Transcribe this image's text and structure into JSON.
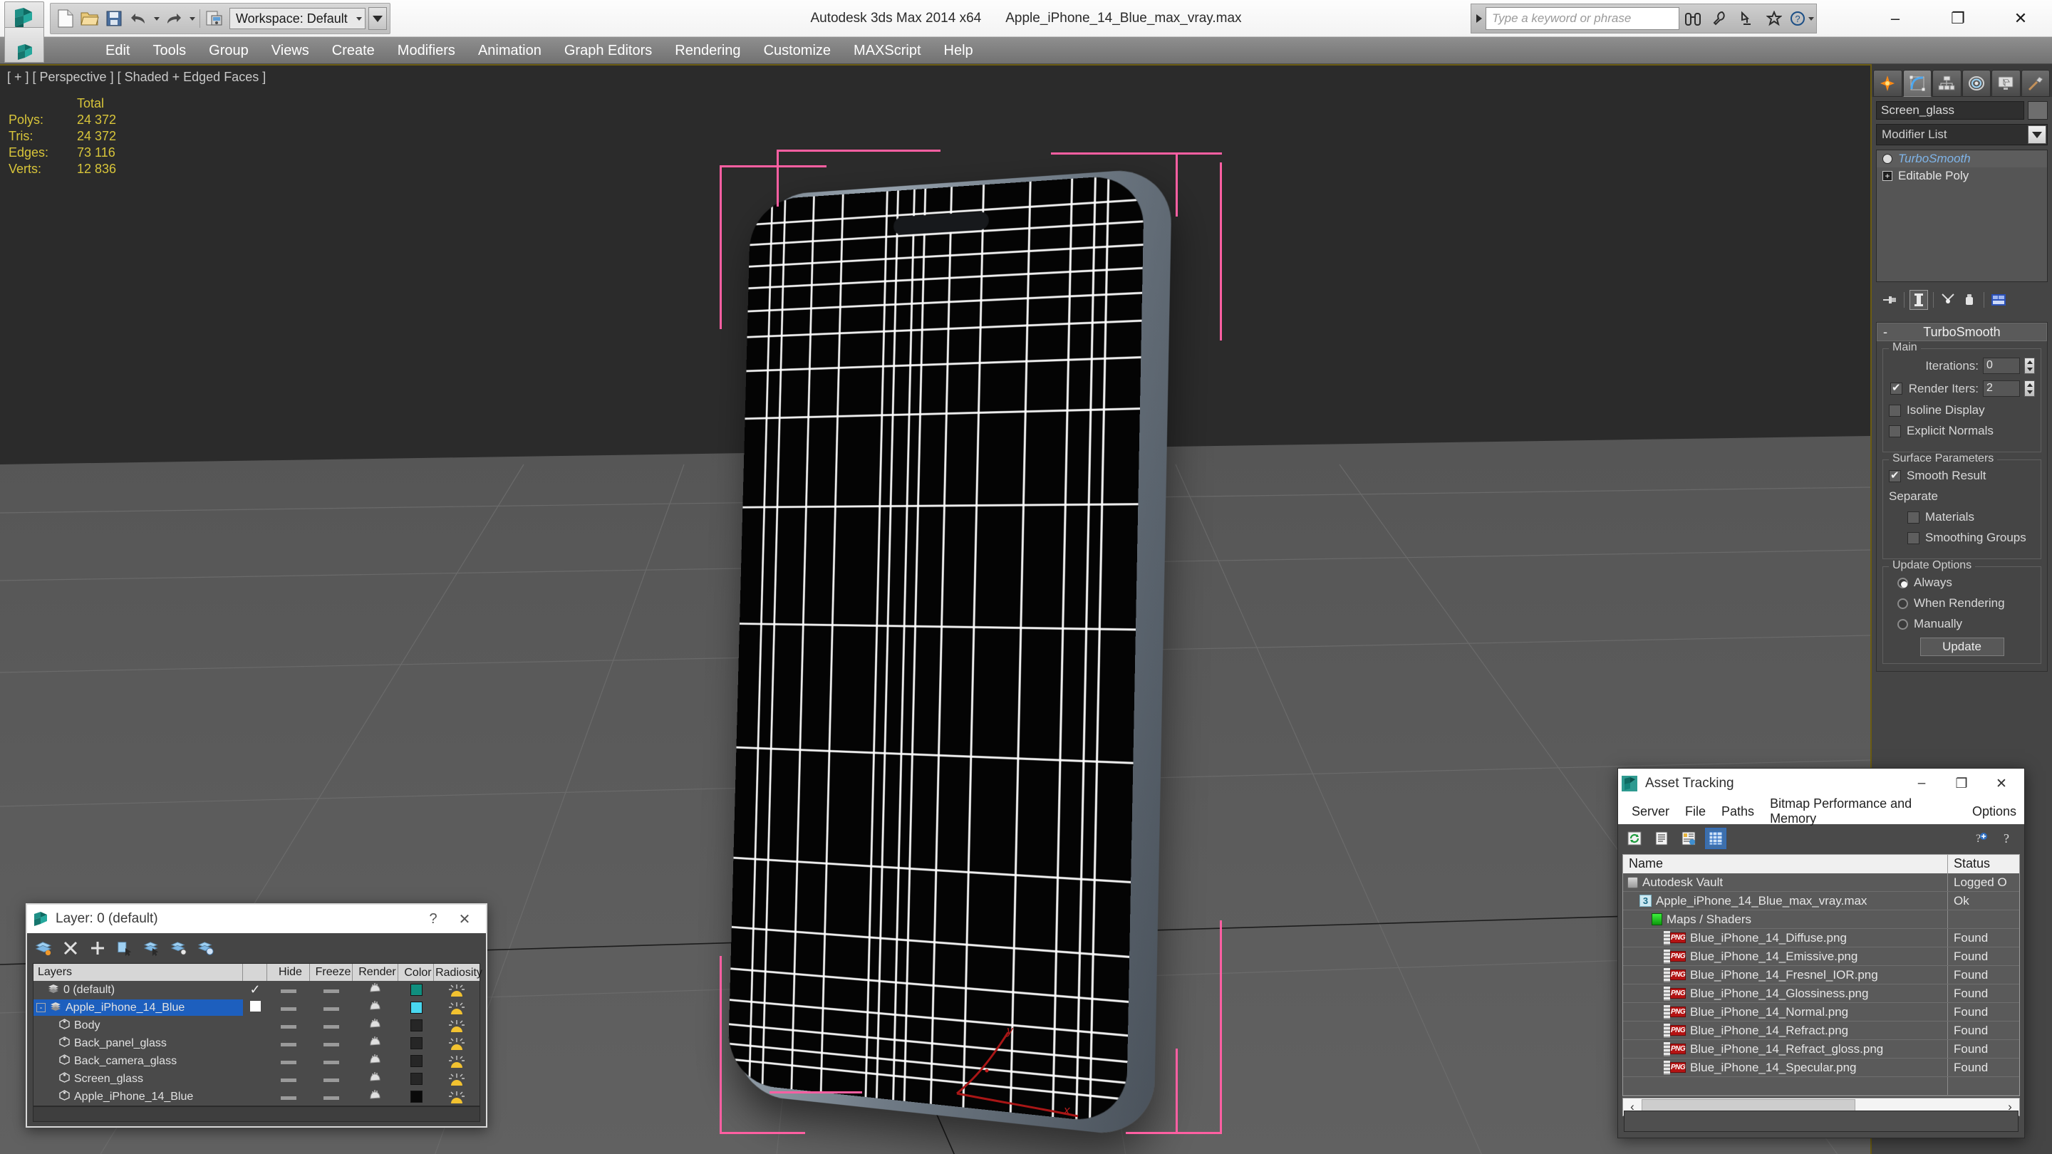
{
  "titlebar": {
    "app_title": "Autodesk 3ds Max  2014 x64",
    "document_title": "Apple_iPhone_14_Blue_max_vray.max",
    "workspace_label": "Workspace: Default",
    "quick_access": [
      {
        "name": "new-file-icon",
        "label": "New"
      },
      {
        "name": "open-file-icon",
        "label": "Open"
      },
      {
        "name": "save-file-icon",
        "label": "Save"
      },
      {
        "name": "undo-icon",
        "label": "Undo"
      },
      {
        "name": "redo-icon",
        "label": "Redo"
      },
      {
        "name": "project-folder-icon",
        "label": "Set Project Folder"
      }
    ],
    "search_placeholder": "Type a keyword or phrase",
    "infocenter_icons": [
      "binoculars-icon",
      "wrench-icon",
      "satellite-icon",
      "star-icon",
      "help-icon"
    ],
    "window_buttons": {
      "minimize": "–",
      "maximize": "❐",
      "close": "✕"
    }
  },
  "menubar": {
    "items": [
      "Edit",
      "Tools",
      "Group",
      "Views",
      "Create",
      "Modifiers",
      "Animation",
      "Graph Editors",
      "Rendering",
      "Customize",
      "MAXScript",
      "Help"
    ]
  },
  "viewport": {
    "label": "[ + ] [ Perspective ] [ Shaded + Edged Faces ]",
    "stats": {
      "column_header": "Total",
      "rows": [
        {
          "label": "Polys:",
          "value": "24 372"
        },
        {
          "label": "Tris:",
          "value": "24 372"
        },
        {
          "label": "Edges:",
          "value": "73 116"
        },
        {
          "label": "Verts:",
          "value": "12 836"
        }
      ]
    },
    "axis_labels": {
      "y": "y",
      "x": "x"
    }
  },
  "command_panel": {
    "tabs": [
      {
        "name": "create-tab",
        "label": "Create"
      },
      {
        "name": "modify-tab",
        "label": "Modify"
      },
      {
        "name": "hierarchy-tab",
        "label": "Hierarchy"
      },
      {
        "name": "motion-tab",
        "label": "Motion"
      },
      {
        "name": "display-tab",
        "label": "Display"
      },
      {
        "name": "utilities-tab",
        "label": "Utilities"
      }
    ],
    "active_tab_index": 1,
    "object_name": "Screen_glass",
    "modifier_list_label": "Modifier List",
    "stack": [
      {
        "label": "TurboSmooth",
        "selected": true
      },
      {
        "label": "Editable Poly",
        "selected": false
      }
    ],
    "stack_tools": [
      "pin-stack-icon",
      "show-end-result-icon",
      "make-unique-icon",
      "remove-modifier-icon",
      "configure-modifier-sets-icon"
    ],
    "rollout": {
      "title": "TurboSmooth",
      "collapse_glyph": "-",
      "main_group": {
        "title": "Main",
        "iterations_label": "Iterations:",
        "iterations_value": "0",
        "render_iters_label": "Render Iters:",
        "render_iters_value": "2",
        "render_iters_checked": true,
        "isoline_display_label": "Isoline Display",
        "isoline_display_checked": false,
        "explicit_normals_label": "Explicit Normals",
        "explicit_normals_checked": false
      },
      "surface_group": {
        "title": "Surface Parameters",
        "smooth_result_label": "Smooth Result",
        "smooth_result_checked": true,
        "separate_label": "Separate",
        "materials_label": "Materials",
        "materials_checked": false,
        "smoothing_groups_label": "Smoothing Groups",
        "smoothing_groups_checked": false
      },
      "update_group": {
        "title": "Update Options",
        "options": [
          {
            "label": "Always",
            "selected": true
          },
          {
            "label": "When Rendering",
            "selected": false
          },
          {
            "label": "Manually",
            "selected": false
          }
        ],
        "update_button": "Update"
      }
    }
  },
  "layer_dialog": {
    "title": "Layer: 0 (default)",
    "help_glyph": "?",
    "close_glyph": "✕",
    "toolbar": [
      "create-new-layer-icon",
      "delete-layer-icon",
      "add-selection-to-layer-icon",
      "select-objects-in-layer-icon",
      "select-highlighted-objects-icon",
      "highlight-selected-objects-layer-icon",
      "layer-properties-icon"
    ],
    "columns": [
      "Layers",
      "",
      "Hide",
      "Freeze",
      "Render",
      "Color",
      "Radiosity"
    ],
    "rows": [
      {
        "name": "0 (default)",
        "indent": 1,
        "type": "layer",
        "current": true,
        "selected": false,
        "color": "#0f8f7f"
      },
      {
        "name": "Apple_iPhone_14_Blue",
        "indent": 0,
        "type": "layer",
        "current": false,
        "selected": true,
        "color": "#49d7ef",
        "expander": "-"
      },
      {
        "name": "Body",
        "indent": 2,
        "type": "object",
        "current": false,
        "selected": false,
        "color": "#262626"
      },
      {
        "name": "Back_panel_glass",
        "indent": 2,
        "type": "object",
        "current": false,
        "selected": false,
        "color": "#262626"
      },
      {
        "name": "Back_camera_glass",
        "indent": 2,
        "type": "object",
        "current": false,
        "selected": false,
        "color": "#262626"
      },
      {
        "name": "Screen_glass",
        "indent": 2,
        "type": "object",
        "current": false,
        "selected": false,
        "color": "#262626"
      },
      {
        "name": "Apple_iPhone_14_Blue",
        "indent": 2,
        "type": "object",
        "current": false,
        "selected": false,
        "color": "#0a0a0a"
      }
    ]
  },
  "asset_tracking": {
    "title": "Asset Tracking",
    "window_buttons": {
      "minimize": "–",
      "maximize": "❐",
      "close": "✕"
    },
    "menu": [
      "Server",
      "File",
      "Paths",
      "Bitmap Performance and Memory",
      "Options"
    ],
    "toolbar": [
      "refresh-icon",
      "list-view-icon",
      "detail-view-icon",
      "grid-view-icon"
    ],
    "toolbar_right": [
      "add-help-icon",
      "help-icon"
    ],
    "active_toolbar_index": 3,
    "columns": [
      "Name",
      "Status"
    ],
    "rows": [
      {
        "name": "Autodesk Vault",
        "status": "Logged O",
        "indent": 0,
        "icon": "vault-icon"
      },
      {
        "name": "Apple_iPhone_14_Blue_max_vray.max",
        "status": "Ok",
        "indent": 1,
        "icon": "max-file-icon"
      },
      {
        "name": "Maps / Shaders",
        "status": "",
        "indent": 2,
        "icon": "maps-shaders-icon"
      },
      {
        "name": "Blue_iPhone_14_Diffuse.png",
        "status": "Found",
        "indent": 3,
        "icon": "png-icon"
      },
      {
        "name": "Blue_iPhone_14_Emissive.png",
        "status": "Found",
        "indent": 3,
        "icon": "png-icon"
      },
      {
        "name": "Blue_iPhone_14_Fresnel_IOR.png",
        "status": "Found",
        "indent": 3,
        "icon": "png-icon"
      },
      {
        "name": "Blue_iPhone_14_Glossiness.png",
        "status": "Found",
        "indent": 3,
        "icon": "png-icon"
      },
      {
        "name": "Blue_iPhone_14_Normal.png",
        "status": "Found",
        "indent": 3,
        "icon": "png-icon"
      },
      {
        "name": "Blue_iPhone_14_Refract.png",
        "status": "Found",
        "indent": 3,
        "icon": "png-icon"
      },
      {
        "name": "Blue_iPhone_14_Refract_gloss.png",
        "status": "Found",
        "indent": 3,
        "icon": "png-icon"
      },
      {
        "name": "Blue_iPhone_14_Specular.png",
        "status": "Found",
        "indent": 3,
        "icon": "png-icon"
      },
      {
        "name": "",
        "status": "",
        "indent": 0,
        "icon": ""
      }
    ],
    "hscroll": {
      "left_arrow": "‹",
      "right_arrow": "›"
    }
  },
  "colors": {
    "accent_selection": "#ff5fa2",
    "stats_text": "#d8c53a",
    "viewport_bg": "#5e5e5e",
    "panel_bg": "#454545",
    "row_selected": "#1d5fbe"
  }
}
